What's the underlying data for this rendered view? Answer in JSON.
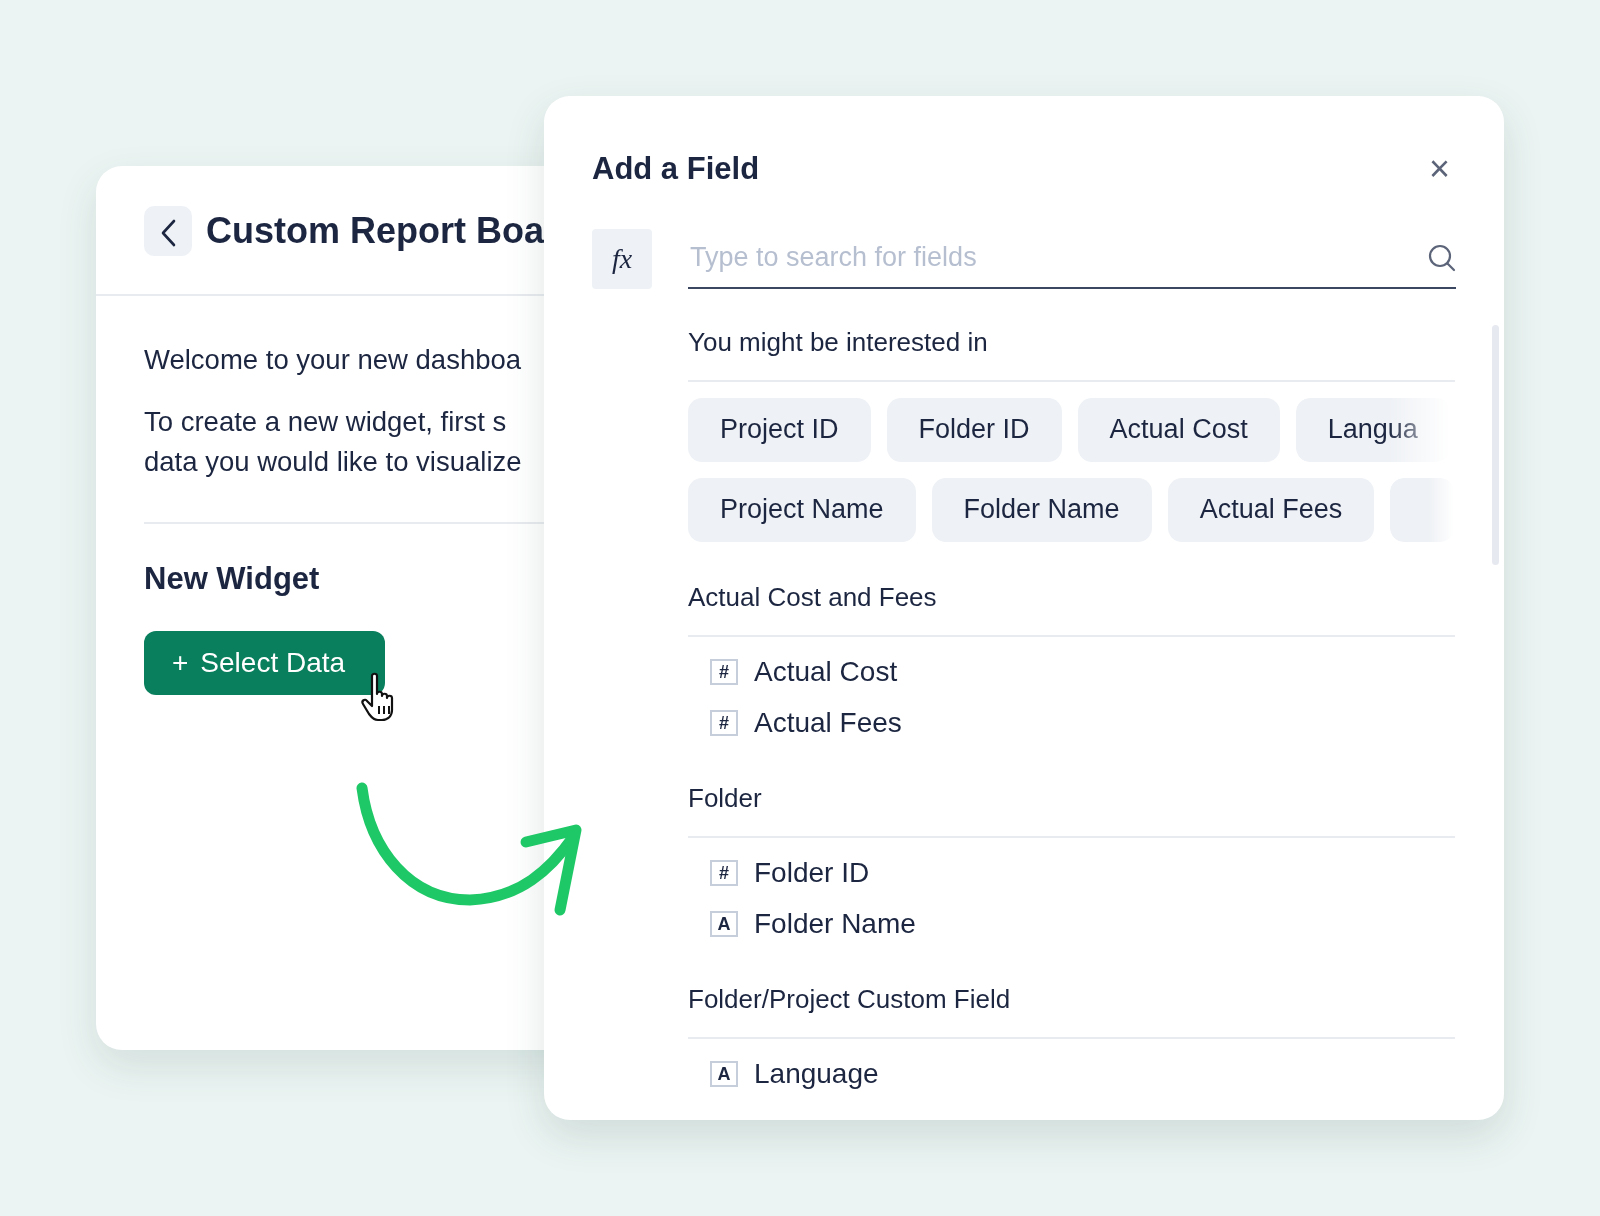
{
  "report_card": {
    "title": "Custom Report Boa",
    "welcome": "Welcome to your new dashboa",
    "instructions": [
      "To create a new widget, first s",
      "data you would like to visualize"
    ],
    "section_title": "New Widget",
    "select_button": {
      "icon": "+",
      "label": "Select Data"
    }
  },
  "dialog": {
    "title": "Add a Field",
    "close": "×",
    "formula_button": "fx",
    "search": {
      "placeholder": "Type to search for fields"
    },
    "suggestions": {
      "title": "You might be interested in",
      "chips": [
        [
          {
            "label": "Project ID"
          },
          {
            "label": "Folder ID"
          },
          {
            "label": "Actual Cost"
          },
          {
            "label": "Langua",
            "faded": true
          }
        ],
        [
          {
            "label": "Project Name"
          },
          {
            "label": "Folder Name"
          },
          {
            "label": "Actual Fees"
          },
          {
            "faded": true
          }
        ]
      ]
    },
    "groups": [
      {
        "title": "Actual Cost and Fees",
        "fields": [
          {
            "type_mark": "#",
            "label": "Actual Cost"
          },
          {
            "type_mark": "#",
            "label": "Actual Fees"
          }
        ]
      },
      {
        "title": "Folder",
        "fields": [
          {
            "type_mark": "#",
            "label": "Folder ID"
          },
          {
            "type_mark": "A",
            "label": "Folder Name"
          }
        ]
      },
      {
        "title": "Folder/Project Custom Field",
        "fields": [
          {
            "type_mark": "A",
            "label": "Language"
          }
        ]
      }
    ]
  }
}
